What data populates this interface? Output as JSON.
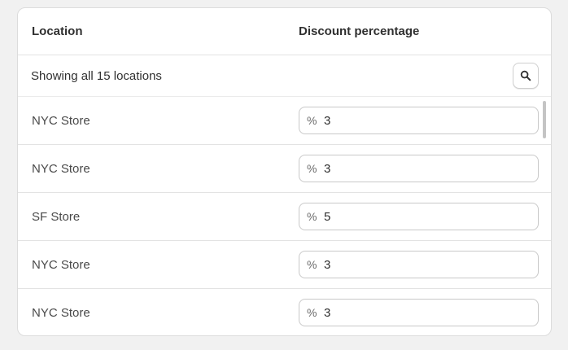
{
  "table": {
    "header": {
      "location": "Location",
      "discount": "Discount percentage"
    },
    "summary": "Showing all 15 locations",
    "search_icon": "search-icon",
    "rows": [
      {
        "location": "NYC Store",
        "prefix": "%",
        "value": "3"
      },
      {
        "location": "NYC Store",
        "prefix": "%",
        "value": "3"
      },
      {
        "location": "SF Store",
        "prefix": "%",
        "value": "5"
      },
      {
        "location": "NYC Store",
        "prefix": "%",
        "value": "3"
      },
      {
        "location": "NYC Store",
        "prefix": "%",
        "value": "3"
      }
    ]
  }
}
